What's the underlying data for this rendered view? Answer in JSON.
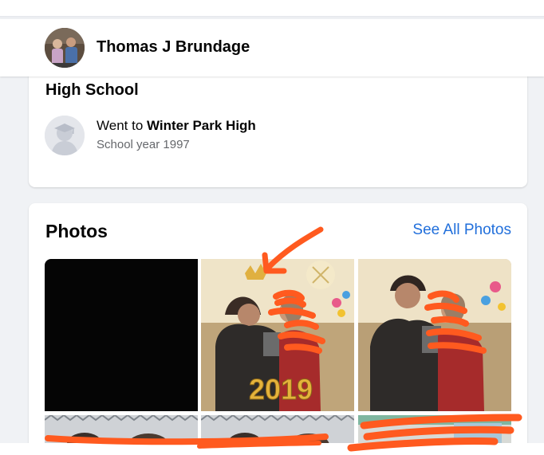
{
  "profile": {
    "name": "Thomas J Brundage"
  },
  "education": {
    "heading": "High School",
    "prefix": "Went to ",
    "school": "Winter Park High",
    "year": "School year 1997"
  },
  "photos": {
    "title": "Photos",
    "see_all": "See All Photos",
    "overlay_text": "2019"
  },
  "colors": {
    "link": "#216fdb",
    "background": "#f0f2f5",
    "annotation": "#ff5a1f"
  }
}
